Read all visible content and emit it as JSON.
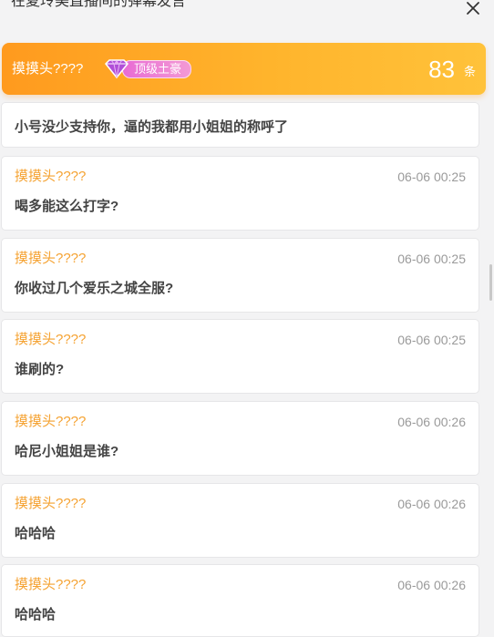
{
  "header": {
    "title": "在夏玲美直播间的弹幕发言",
    "close_icon": "close-icon"
  },
  "banner": {
    "username": "摸摸头????",
    "badge_icon": "purple-gem-icon",
    "badge_label": "顶级土豪",
    "count": "83",
    "count_unit": "条",
    "colors": {
      "from": "#ff9a1e",
      "to": "#ffc23a"
    }
  },
  "messages": [
    {
      "author": "",
      "time": "",
      "text": "小号没少支持你，逼的我都用小姐姐的称呼了"
    },
    {
      "author": "摸摸头????",
      "time": "06-06 00:25",
      "text": "喝多能这么打字?"
    },
    {
      "author": "摸摸头????",
      "time": "06-06 00:25",
      "text": "你收过几个爱乐之城全服?"
    },
    {
      "author": "摸摸头????",
      "time": "06-06 00:25",
      "text": "谁刷的?"
    },
    {
      "author": "摸摸头????",
      "time": "06-06 00:26",
      "text": "哈尼小姐姐是谁?"
    },
    {
      "author": "摸摸头????",
      "time": "06-06 00:26",
      "text": "哈哈哈"
    },
    {
      "author": "摸摸头????",
      "time": "06-06 00:26",
      "text": "哈哈哈"
    }
  ],
  "accent_color": "#f5a231"
}
